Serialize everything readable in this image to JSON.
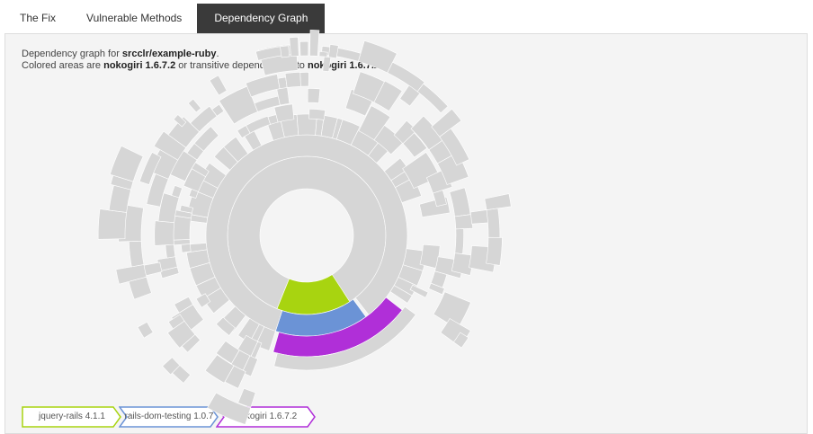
{
  "tabs": [
    {
      "label": "The Fix"
    },
    {
      "label": "Vulnerable Methods"
    },
    {
      "label": "Dependency Graph",
      "active": true
    }
  ],
  "description": {
    "line1_prefix": "Dependency graph for ",
    "repo": "srcclr/example-ruby",
    "line1_suffix": ".",
    "line2_prefix": "Colored areas are ",
    "lib1": "nokogiri 1.6.7.2",
    "line2_mid": " or transitive dependencies to ",
    "lib2": "nokogiri 1.6.7.2",
    "line2_suffix": "."
  },
  "colors": {
    "jquery": "#a8d410",
    "rails_dom": "#6b93d6",
    "nokogiri": "#b02fd8",
    "gray": "#d6d6d6"
  },
  "chart_data": {
    "type": "sunburst",
    "highlighted_path": [
      "jquery-rails 4.1.1",
      "rails-dom-testing 1.0.7",
      "nokogiri 1.6.7.2"
    ]
  },
  "breadcrumbs": [
    {
      "label": "jquery-rails 4.1.1",
      "color": "#a8d410"
    },
    {
      "label": "rails-dom-testing 1.0.7",
      "color": "#6b93d6"
    },
    {
      "label": "nokogiri 1.6.7.2",
      "color": "#b02fd8"
    }
  ]
}
